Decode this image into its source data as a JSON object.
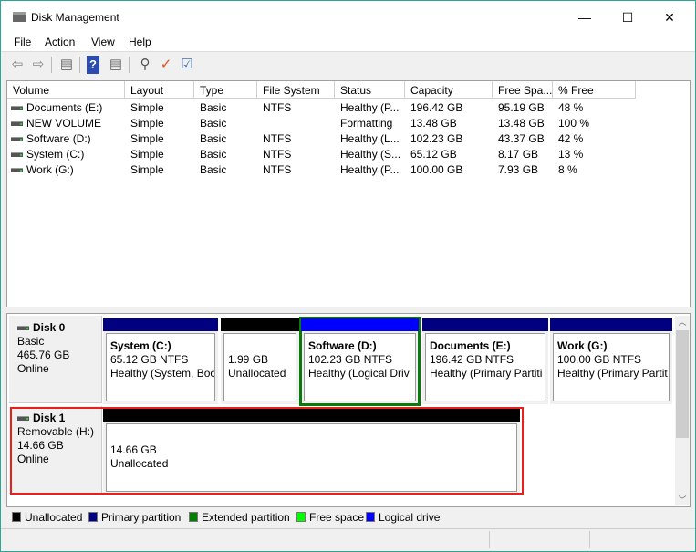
{
  "window": {
    "title": "Disk Management",
    "minimize": "—",
    "maximize": "☐",
    "close": "✕"
  },
  "menu": [
    "File",
    "Action",
    "View",
    "Help"
  ],
  "toolbar": [
    "back-icon",
    "forward-icon",
    "console-tree-icon",
    "help-icon",
    "action-pane-icon",
    "connect-icon",
    "properties-icon",
    "settings-icon"
  ],
  "list": {
    "columns": [
      "Volume",
      "Layout",
      "Type",
      "File System",
      "Status",
      "Capacity",
      "Free Spa...",
      "% Free"
    ],
    "rows": [
      [
        "Documents (E:)",
        "Simple",
        "Basic",
        "NTFS",
        "Healthy (P...",
        "196.42 GB",
        "95.19 GB",
        "48 %"
      ],
      [
        "NEW VOLUME",
        "Simple",
        "Basic",
        "",
        "Formatting",
        "13.48 GB",
        "13.48 GB",
        "100 %"
      ],
      [
        "Software (D:)",
        "Simple",
        "Basic",
        "NTFS",
        "Healthy (L...",
        "102.23 GB",
        "43.37 GB",
        "42 %"
      ],
      [
        "System (C:)",
        "Simple",
        "Basic",
        "NTFS",
        "Healthy (S...",
        "65.12 GB",
        "8.17 GB",
        "13 %"
      ],
      [
        "Work (G:)",
        "Simple",
        "Basic",
        "NTFS",
        "Healthy (P...",
        "100.00 GB",
        "7.93 GB",
        "8 %"
      ]
    ]
  },
  "disks": [
    {
      "name": "Disk 0",
      "type": "Basic",
      "size": "465.76 GB",
      "state": "Online",
      "partitions": [
        {
          "name": "System  (C:)",
          "size": "65.12 GB NTFS",
          "status": "Healthy (System, Boo",
          "color": "#000080"
        },
        {
          "name": "",
          "size": "1.99 GB",
          "status": "Unallocated",
          "color": "#000000"
        },
        {
          "name": "Software  (D:)",
          "size": "102.23 GB NTFS",
          "status": "Healthy (Logical Driv",
          "color": "#0000ff"
        },
        {
          "name": "Documents  (E:)",
          "size": "196.42 GB NTFS",
          "status": "Healthy (Primary Partiti",
          "color": "#000080"
        },
        {
          "name": "Work  (G:)",
          "size": "100.00 GB NTFS",
          "status": "Healthy (Primary Partit",
          "color": "#000080"
        }
      ]
    },
    {
      "name": "Disk 1",
      "type": "Removable (H:)",
      "size": "14.66 GB",
      "state": "Online",
      "partitions": [
        {
          "name": "",
          "size": "14.66 GB",
          "status": "Unallocated",
          "color": "#000000"
        }
      ]
    }
  ],
  "legend": [
    {
      "label": "Unallocated",
      "color": "#000000"
    },
    {
      "label": "Primary partition",
      "color": "#000080"
    },
    {
      "label": "Extended partition",
      "color": "#008000"
    },
    {
      "label": "Free space",
      "color": "#00ff00"
    },
    {
      "label": "Logical drive",
      "color": "#0000ff"
    }
  ]
}
